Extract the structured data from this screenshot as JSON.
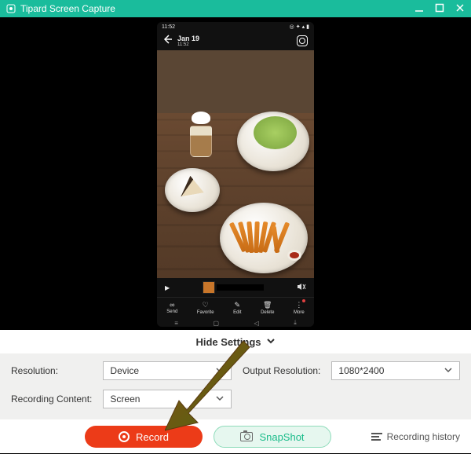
{
  "window": {
    "title": "Tipard Screen Capture"
  },
  "phone": {
    "status_time": "11:52",
    "date": "Jan 19",
    "time": "11:52",
    "actions": [
      {
        "icon": "share",
        "label": "Send"
      },
      {
        "icon": "heart",
        "label": "Favorite"
      },
      {
        "icon": "pencil",
        "label": "Edit"
      },
      {
        "icon": "trash",
        "label": "Delete"
      },
      {
        "icon": "more",
        "label": "More"
      }
    ]
  },
  "toggle": {
    "label": "Hide Settings"
  },
  "settings": {
    "resolution": {
      "label": "Resolution:",
      "value": "Device"
    },
    "recording_content": {
      "label": "Recording Content:",
      "value": "Screen"
    },
    "output_resolution": {
      "label": "Output Resolution:",
      "value": "1080*2400"
    }
  },
  "footer": {
    "record": "Record",
    "snapshot": "SnapShot",
    "history": "Recording history"
  }
}
